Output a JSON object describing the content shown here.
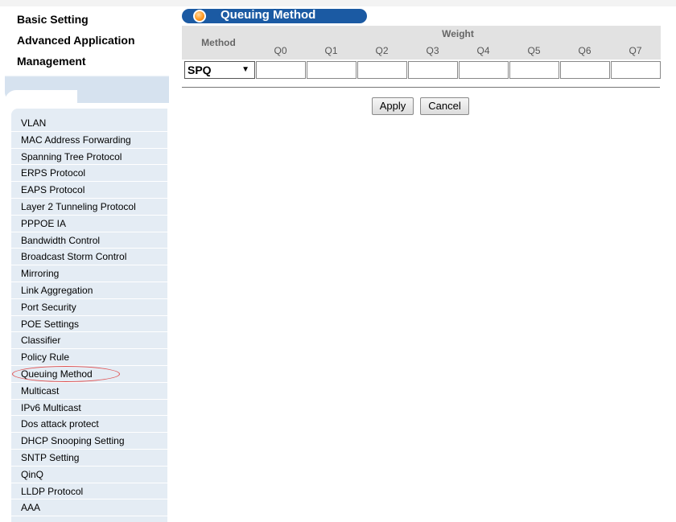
{
  "top_menu": {
    "items": [
      "Basic Setting",
      "Advanced Application",
      "Management"
    ]
  },
  "sub_menu": {
    "items": [
      "VLAN",
      "MAC Address Forwarding",
      "Spanning Tree Protocol",
      "ERPS Protocol",
      "EAPS Protocol",
      "Layer 2 Tunneling Protocol",
      "PPPOE IA",
      "Bandwidth Control",
      "Broadcast Storm Control",
      "Mirroring",
      "Link Aggregation",
      "Port Security",
      "POE Settings",
      "Classifier",
      "Policy Rule",
      "Queuing Method",
      "Multicast",
      "IPv6 Multicast",
      "Dos attack protect",
      "DHCP Snooping Setting",
      "SNTP Setting",
      "QinQ",
      "LLDP Protocol",
      "AAA"
    ],
    "highlighted": "Queuing Method"
  },
  "page": {
    "title": "Queuing Method"
  },
  "table": {
    "method_header": "Method",
    "weight_header": "Weight",
    "queues": [
      "Q0",
      "Q1",
      "Q2",
      "Q3",
      "Q4",
      "Q5",
      "Q6",
      "Q7"
    ],
    "method_value": "SPQ",
    "dropdown_arrow": "▼"
  },
  "buttons": {
    "apply": "Apply",
    "cancel": "Cancel"
  },
  "colors": {
    "title_bar": "#1b5aa3",
    "menu_bg": "#e4ecf4",
    "header_bg": "#e2e2e2",
    "highlight_circle": "#e05050"
  }
}
